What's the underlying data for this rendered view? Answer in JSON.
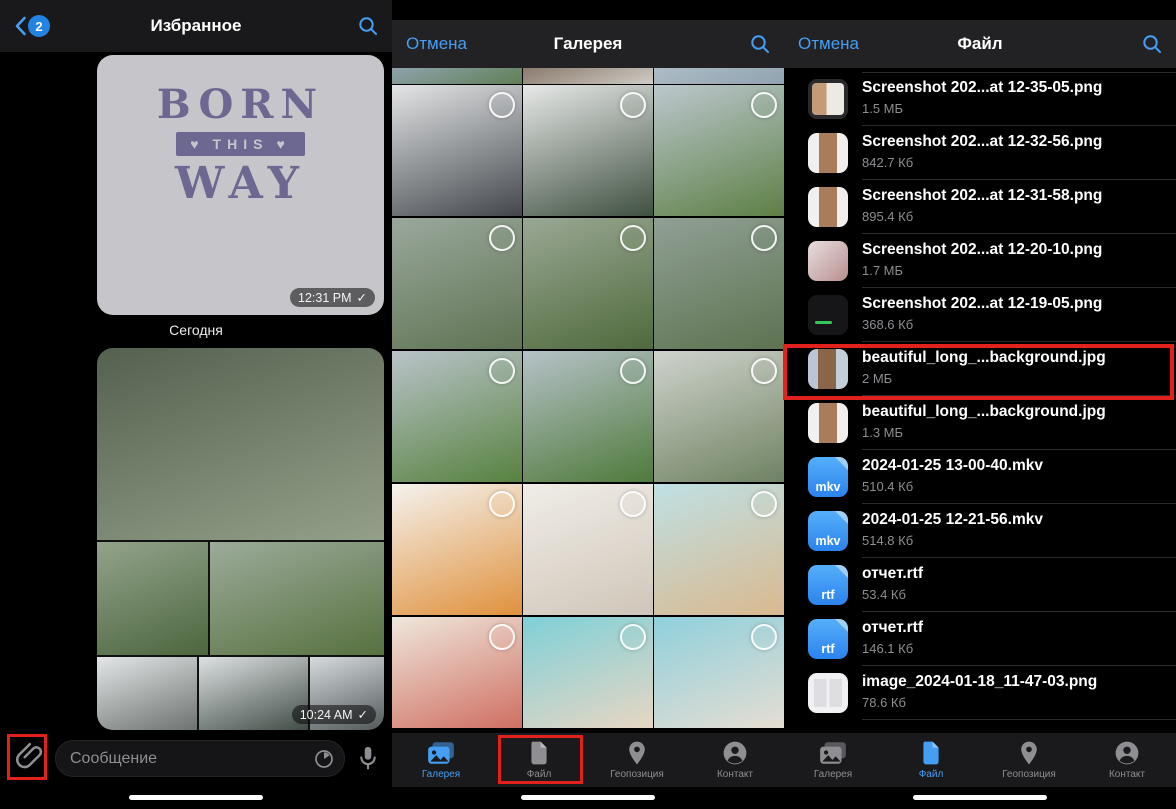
{
  "colors": {
    "accent": "#459EF3",
    "highlight_red": "#E2211C",
    "file_icon_blue_top": "#56AFFA",
    "file_icon_blue_bottom": "#2B83EE"
  },
  "left_panel": {
    "header": {
      "back_badge": "2",
      "title": "Избранное"
    },
    "sticker_message": {
      "word_top": "BORN",
      "banner_word": "THIS",
      "heart": "♥",
      "word_bottom": "WAY",
      "time": "12:31 PM",
      "status_check": "✓"
    },
    "date_separator": "Сегодня",
    "album_message": {
      "time": "10:24 AM",
      "status_check": "✓",
      "photos": [
        {
          "name": "family-picnic-lake-photo",
          "c1": "#55614f",
          "c2": "#93a089"
        },
        {
          "name": "family-fence-photo",
          "c1": "#93a38b",
          "c2": "#4c663e"
        },
        {
          "name": "family-bench-dog-photo",
          "c1": "#9cab9a",
          "c2": "#57713f"
        },
        {
          "name": "winter-wedding-photo-1",
          "c1": "#e3e6e7",
          "c2": "#6d7370"
        },
        {
          "name": "winter-wedding-photo-2",
          "c1": "#dde2e3",
          "c2": "#414c46"
        },
        {
          "name": "winter-wedding-photo-3",
          "c1": "#d6dbde",
          "c2": "#53585a"
        }
      ]
    },
    "composer": {
      "placeholder": "Сообщение"
    }
  },
  "middle_panel": {
    "header": {
      "cancel": "Отмена",
      "title": "Галерея"
    },
    "active_tab": "Галерея",
    "gallery_tiles": [
      {
        "name": "photo-strip-1",
        "c1": "#8fa3ae",
        "c2": "#5f7f55",
        "sliver": true
      },
      {
        "name": "photo-strip-2",
        "c1": "#8a7a6d",
        "c2": "#cfcbc4",
        "sliver": true
      },
      {
        "name": "photo-strip-3",
        "c1": "#aebcc6",
        "c2": "#8fa3b0",
        "sliver": true
      },
      {
        "name": "wedding-couple-snow-photo",
        "c1": "#e3e5e6",
        "c2": "#43474c"
      },
      {
        "name": "couple-kissing-snow-tree-photo",
        "c1": "#e7e9e8",
        "c2": "#3f5040"
      },
      {
        "name": "family-corgi-grass-photo",
        "c1": "#bcc7cd",
        "c2": "#5d8046"
      },
      {
        "name": "family-dog-bench-lake-photo",
        "c1": "#9aa89c",
        "c2": "#5f7352"
      },
      {
        "name": "family-on-fence-photo",
        "c1": "#9aa894",
        "c2": "#4f6a3c"
      },
      {
        "name": "family-eating-lake-photo",
        "c1": "#90a095",
        "c2": "#5d7350"
      },
      {
        "name": "family-corgi-field-wide-photo",
        "c1": "#b9c3c9",
        "c2": "#57823f"
      },
      {
        "name": "family-corgi-field-photo",
        "c1": "#b6c2c8",
        "c2": "#4f7a3b"
      },
      {
        "name": "family-kiss-closeup-photo",
        "c1": "#cfd3cd",
        "c2": "#6f8261"
      },
      {
        "name": "orange-kitten-photo",
        "c1": "#f4f2ee",
        "c2": "#e0913c"
      },
      {
        "name": "white-kitten-photo",
        "c1": "#f0ede8",
        "c2": "#cfc6b8"
      },
      {
        "name": "family-beach-bucket-photo",
        "c1": "#bfe0e4",
        "c2": "#d9b98f"
      },
      {
        "name": "family-watermelon-beach-photo",
        "c1": "#efe7dc",
        "c2": "#cf6f62"
      },
      {
        "name": "family-beach-turquoise-photo",
        "c1": "#7fd0d8",
        "c2": "#e7d6c3"
      },
      {
        "name": "family-beach-walk-photo",
        "c1": "#8fd0dc",
        "c2": "#e5ddd2"
      }
    ]
  },
  "right_panel": {
    "header": {
      "cancel": "Отмена",
      "title": "Файл"
    },
    "active_tab": "Файл",
    "files": [
      {
        "name": "Screenshot 202...at 12-35-05.png",
        "size": "1.5 МБ",
        "thumb": "screenshot-dark"
      },
      {
        "name": "Screenshot 202...at 12-32-56.png",
        "size": "842.7 Кб",
        "thumb": "portrait-light"
      },
      {
        "name": "Screenshot 202...at 12-31-58.png",
        "size": "895.4 Кб",
        "thumb": "portrait-light"
      },
      {
        "name": "Screenshot 202...at 12-20-10.png",
        "size": "1.7 МБ",
        "thumb": "photo-room"
      },
      {
        "name": "Screenshot 202...at 12-19-05.png",
        "size": "368.6 Кб",
        "thumb": "terminal-dark"
      },
      {
        "name": "beautiful_long_...background.jpg",
        "size": "2 МБ",
        "thumb": "portrait-city",
        "highlighted": true
      },
      {
        "name": "beautiful_long_...background.jpg",
        "size": "1.3 МБ",
        "thumb": "portrait-light"
      },
      {
        "name": "2024-01-25 13-00-40.mkv",
        "size": "510.4 Кб",
        "thumb": "filetype",
        "ext": "mkv"
      },
      {
        "name": "2024-01-25 12-21-56.mkv",
        "size": "514.8 Кб",
        "thumb": "filetype",
        "ext": "mkv"
      },
      {
        "name": "отчет.rtf",
        "size": "53.4 Кб",
        "thumb": "filetype",
        "ext": "rtf"
      },
      {
        "name": "отчет.rtf",
        "size": "146.1 Кб",
        "thumb": "filetype",
        "ext": "rtf"
      },
      {
        "name": "image_2024-01-18_11-47-03.png",
        "size": "78.6 Кб",
        "thumb": "collage-white"
      }
    ]
  },
  "tab_bar": {
    "items": [
      {
        "label": "Галерея",
        "icon": "gallery"
      },
      {
        "label": "Файл",
        "icon": "file"
      },
      {
        "label": "Геопозиция",
        "icon": "location"
      },
      {
        "label": "Контакт",
        "icon": "contact"
      }
    ]
  }
}
